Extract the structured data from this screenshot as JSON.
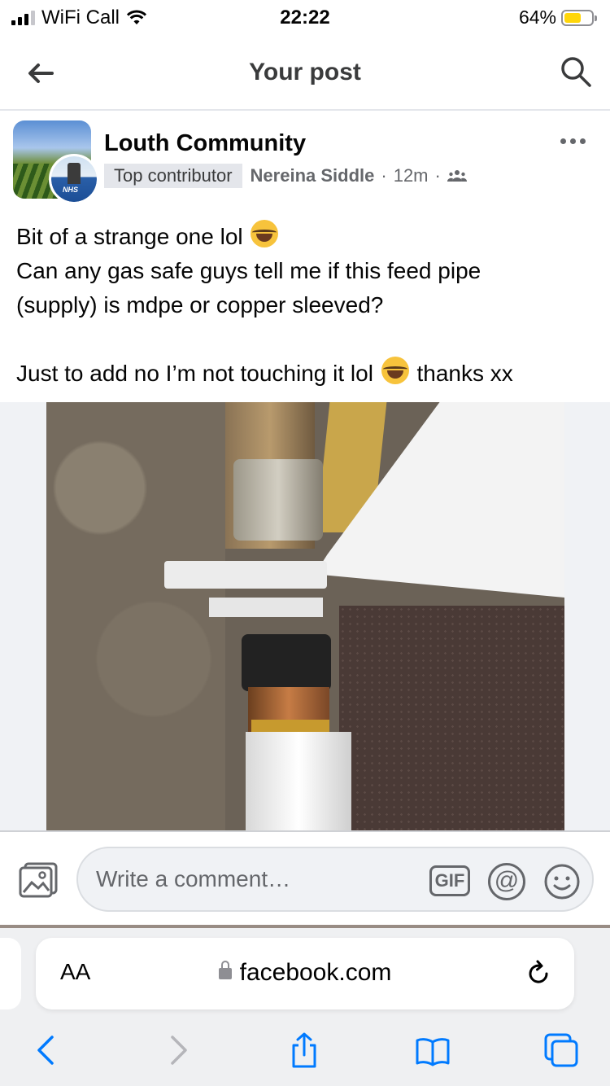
{
  "status_bar": {
    "carrier": "WiFi Call",
    "time": "22:22",
    "battery": "64%",
    "battery_level": 0.64
  },
  "header": {
    "title": "Your post"
  },
  "post": {
    "group_name": "Louth Community",
    "badge": "Top contributor",
    "author": "Nereina Siddle",
    "time": "12m",
    "avatar_text": "NHS",
    "text_lines": [
      "Bit of a strange one lol",
      "Can any gas safe guys tell me if this feed pipe",
      "(supply) is mdpe or copper sleeved?",
      "Just to add no I’m not touching it lol",
      "thanks xx"
    ]
  },
  "comment": {
    "placeholder": "Write a comment…",
    "gif_label": "GIF",
    "at_label": "@"
  },
  "browser": {
    "aa_label": "AA",
    "url": "facebook.com"
  },
  "colors": {
    "accent": "#007aff",
    "secondary_text": "#65676b",
    "battery": "#ffd60a"
  }
}
